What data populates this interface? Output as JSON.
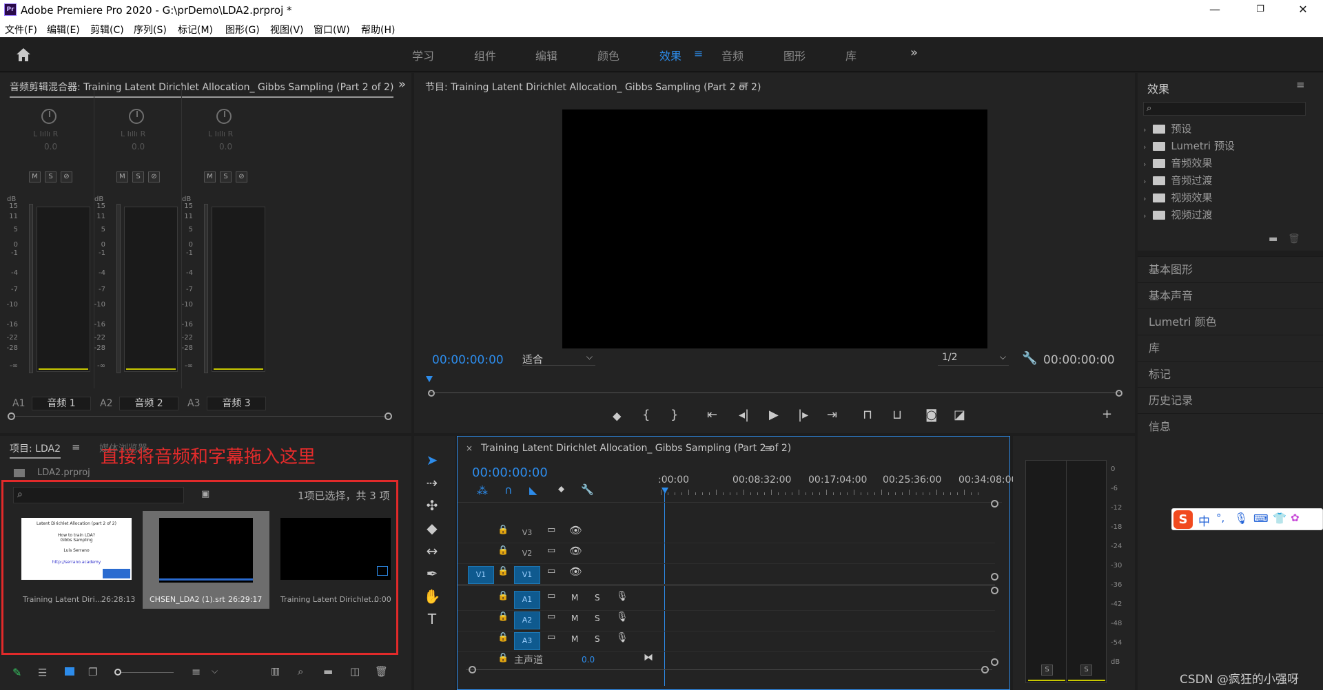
{
  "app": {
    "logo": "Pr",
    "title": "Adobe Premiere Pro 2020 - G:\\prDemo\\LDA2.prproj *",
    "win_min": "—",
    "win_restore": "❐",
    "win_close": "✕"
  },
  "menu": [
    "文件(F)",
    "编辑(E)",
    "剪辑(C)",
    "序列(S)",
    "标记(M)",
    "图形(G)",
    "视图(V)",
    "窗口(W)",
    "帮助(H)"
  ],
  "workspaces": [
    "学习",
    "组件",
    "编辑",
    "颜色",
    "效果",
    "音频",
    "图形",
    "库"
  ],
  "workspace_active": "效果",
  "audio_mixer": {
    "title": "音频剪辑混合器: Training Latent Dirichlet Allocation_ Gibbs Sampling (Part 2 of 2)",
    "channels": [
      {
        "id": "A1",
        "name": "音频 1",
        "value": "0.0",
        "lr": "L Iıllı R"
      },
      {
        "id": "A2",
        "name": "音频 2",
        "value": "0.0",
        "lr": "L Iıllı R"
      },
      {
        "id": "A3",
        "name": "音频 3",
        "value": "0.0",
        "lr": "L Iıllı R"
      }
    ],
    "m": "M",
    "s": "S",
    "o": "⊘",
    "db": "dB",
    "scale": [
      "15",
      "11",
      "5",
      "0",
      "-1",
      "-4",
      "-7",
      "-10",
      "-16",
      "-22",
      "-28",
      "-∞"
    ]
  },
  "program": {
    "title": "节目: Training Latent Dirichlet Allocation_ Gibbs Sampling (Part 2 of 2)",
    "timecode_left": "00:00:00:00",
    "fit": "适合",
    "resolution": "1/2",
    "timecode_right": "00:00:00:00"
  },
  "effects": {
    "title": "效果",
    "items": [
      "预设",
      "Lumetri 预设",
      "音频效果",
      "音频过渡",
      "视频效果",
      "视频过渡"
    ],
    "side": [
      "基本图形",
      "基本声音",
      "Lumetri 颜色",
      "库",
      "标记",
      "历史记录",
      "信息"
    ]
  },
  "project": {
    "tab1": "项目: LDA2",
    "tab2": "媒体浏览器",
    "file": "LDA2.prproj",
    "selection": "1项已选择，共 3 项",
    "overlay": "直接将音频和字幕拖入这里",
    "slide": {
      "line1": "Latent Dirichlet Allocation (part 2 of 2)",
      "line2": "How to train LDA?",
      "line3": "Gibbs Sampling",
      "line4": "Luis Serrano",
      "line5": "http://serrano.academy"
    },
    "items": [
      {
        "name": "Training Latent Diri...",
        "dur": "26:28:13"
      },
      {
        "name": "CHSEN_LDA2 (1).srt",
        "dur": "26:29:17"
      },
      {
        "name": "Training Latent Dirichlet...",
        "dur": "0:00"
      }
    ]
  },
  "timeline": {
    "title": "Training Latent Dirichlet Allocation_ Gibbs Sampling (Part 2 of 2)",
    "timecode": "00:00:00:00",
    "ruler": [
      ":00:00",
      "00:08:32:00",
      "00:17:04:00",
      "00:25:36:00",
      "00:34:08:00"
    ],
    "video": [
      "V3",
      "V2",
      "V1"
    ],
    "audio": [
      "A1",
      "A2",
      "A3"
    ],
    "source_v": "V1",
    "master": "主声道",
    "master_val": "0.0",
    "m": "M",
    "s": "S"
  },
  "meter_scale": [
    "0",
    "-6",
    "-12",
    "-18",
    "-24",
    "-30",
    "-36",
    "-42",
    "-48",
    "-54",
    "dB"
  ],
  "meter_s": "S",
  "watermark": "CSDN @疯狂的小强呀",
  "ime": {
    "logo": "S",
    "lang": "中",
    "punct": "°,"
  }
}
